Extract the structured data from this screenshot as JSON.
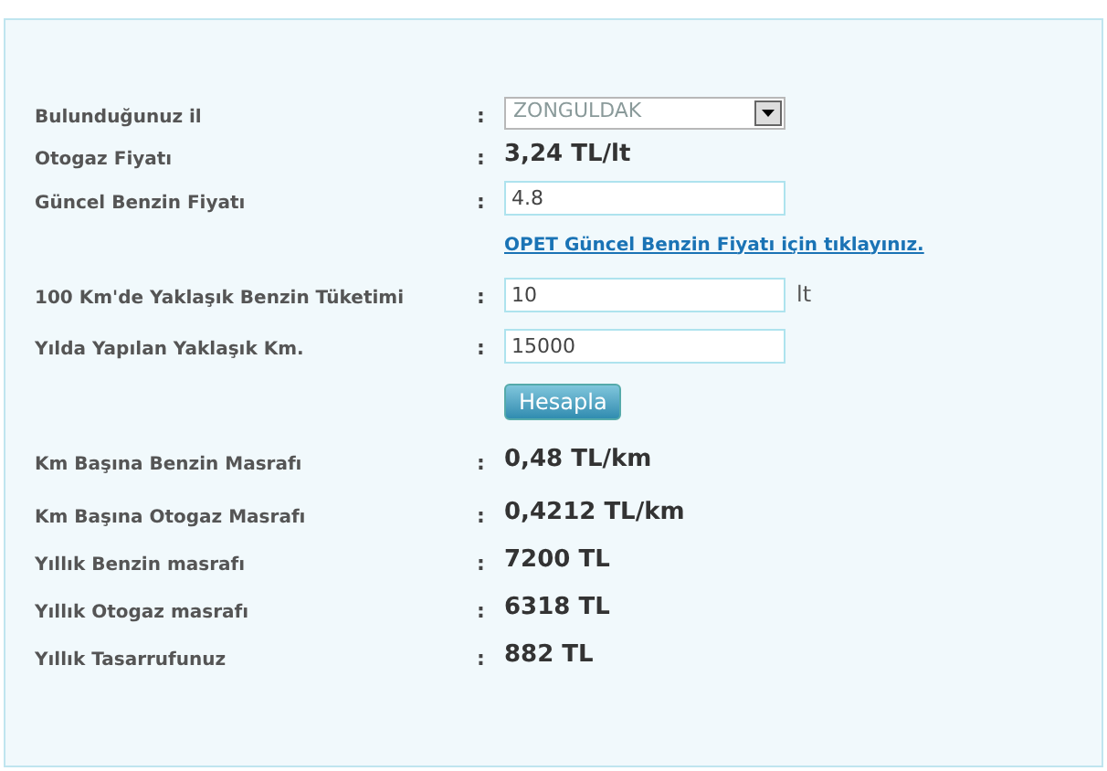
{
  "rows": [
    {
      "kind": "select",
      "label": "Bulunduğunuz il",
      "colon": ":",
      "value": "ZONGULDAK"
    },
    {
      "kind": "value",
      "label": "Otogaz Fiyatı",
      "colon": ":",
      "value": "3,24 TL/lt"
    },
    {
      "kind": "input",
      "label": "Güncel Benzin Fiyatı",
      "colon": ":",
      "value": "4.8"
    },
    {
      "kind": "link",
      "value": "OPET Güncel Benzin Fiyatı için tıklayınız."
    },
    {
      "kind": "input",
      "label": "100 Km'de Yaklaşık Benzin Tüketimi",
      "colon": ":",
      "value": "10",
      "unit": "lt"
    },
    {
      "kind": "input",
      "label": "Yılda Yapılan Yaklaşık Km.",
      "colon": ":",
      "value": "15000"
    },
    {
      "kind": "button",
      "value": "Hesapla"
    },
    {
      "kind": "value",
      "label": "Km Başına Benzin Masrafı",
      "colon": ":",
      "value": "0,48 TL/km"
    },
    {
      "kind": "value",
      "label": "Km Başına Otogaz Masrafı",
      "colon": ":",
      "value": "0,4212 TL/km"
    },
    {
      "kind": "value",
      "label": "Yıllık Benzin masrafı",
      "colon": ":",
      "value": "7200 TL"
    },
    {
      "kind": "value",
      "label": "Yıllık Otogaz masrafı",
      "colon": ":",
      "value": "6318 TL"
    },
    {
      "kind": "value",
      "label": "Yıllık Tasarrufunuz",
      "colon": ":",
      "value": "882 TL"
    }
  ]
}
